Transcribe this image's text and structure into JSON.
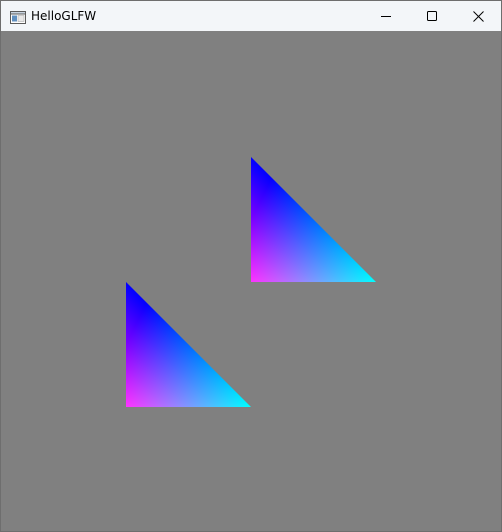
{
  "window": {
    "title": "HelloGLFW",
    "icon": "app-window-icon",
    "controls": [
      "minimize-icon",
      "maximize-icon",
      "close-icon"
    ]
  },
  "canvas": {
    "background_color": "#808080",
    "triangles": [
      {
        "vertex_colors": {
          "top": "#0000ff",
          "bottom_left": "#ff0000",
          "bottom_right": "#00ff00"
        }
      },
      {
        "vertex_colors": {
          "top": "#0000ff",
          "bottom_left": "#ff0000",
          "bottom_right": "#00ff00"
        }
      }
    ]
  }
}
